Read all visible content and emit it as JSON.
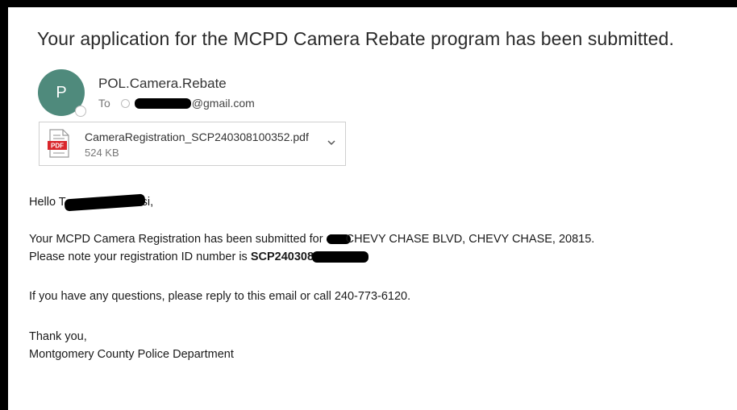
{
  "email": {
    "subject": "Your application for the MCPD Camera Rebate program has been submitted.",
    "sender": {
      "avatar_initial": "P",
      "name": "POL.Camera.Rebate",
      "to_label": "To",
      "to_email_visible": "@gmail.com"
    },
    "attachment": {
      "filename": "CameraRegistration_SCP240308100352.pdf",
      "size": "524 KB",
      "icon_label": "PDF"
    },
    "body": {
      "greeting_start": "Hello T",
      "greeting_end": "si,",
      "reg_text_start": "Your MCPD Camera Registration has been submitted for 4",
      "reg_text_end": "CHEVY CHASE BLVD, CHEVY CHASE, 20815.",
      "id_text": "Please note your registration ID number is ",
      "id_visible": "SCP240308",
      "questions": "If you have any questions, please reply to this email or call 240-773-6120.",
      "closing": "Thank you,",
      "signature": "Montgomery County Police Department"
    }
  },
  "colors": {
    "avatar": "#4f8a7c",
    "pdf_red": "#d9262b",
    "frame": "#000000"
  }
}
